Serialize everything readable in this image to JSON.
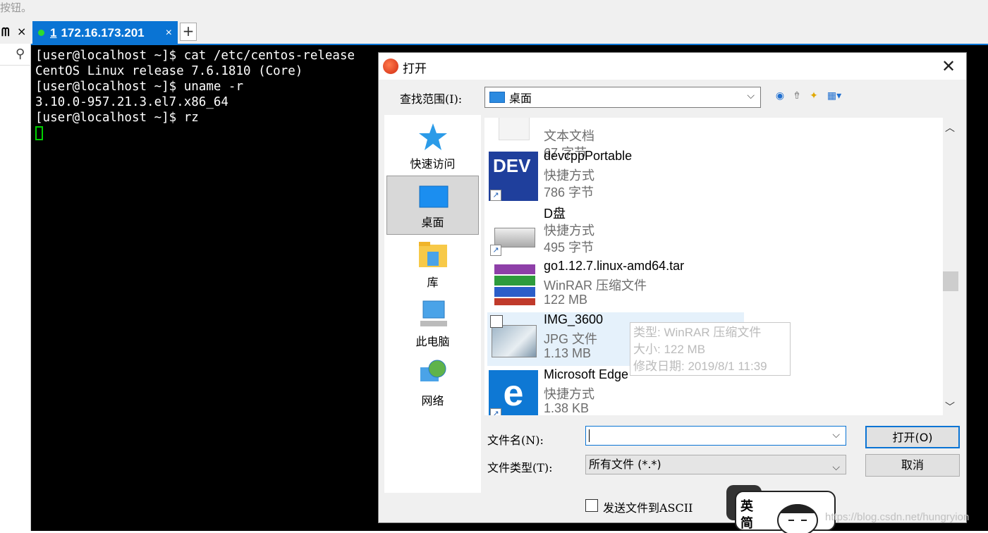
{
  "hint_text": "按钮。",
  "left_tab": {
    "pin_label": "ᗰ",
    "close_label": "×"
  },
  "session_tab": {
    "number": "1",
    "host": "172.16.173.201",
    "close_label": "×",
    "add_label": "+"
  },
  "terminal": {
    "lines": [
      "[user@localhost ~]$ cat /etc/centos-release",
      "CentOS Linux release 7.6.1810 (Core)",
      "[user@localhost ~]$ uname -r",
      "3.10.0-957.21.3.el7.x86_64",
      "[user@localhost ~]$ rz"
    ]
  },
  "dialog": {
    "title": "打开",
    "close_label": "✕",
    "lookin_label": "查找范围(I):",
    "lookin_value": "桌面",
    "places": [
      {
        "label": "快速访问",
        "icon": "star-icon"
      },
      {
        "label": "桌面",
        "icon": "desktop-icon"
      },
      {
        "label": "库",
        "icon": "library-folder-icon"
      },
      {
        "label": "此电脑",
        "icon": "computer-icon"
      },
      {
        "label": "网络",
        "icon": "network-icon"
      }
    ],
    "files": [
      {
        "name": "",
        "type": "文本文档",
        "size": "67 字节",
        "icon": "text-file-icon"
      },
      {
        "name": "devcppPortable",
        "type": "快捷方式",
        "size": "786 字节",
        "icon": "devcpp-icon"
      },
      {
        "name": "D盘",
        "type": "快捷方式",
        "size": "495 字节",
        "icon": "drive-icon"
      },
      {
        "name": "go1.12.7.linux-amd64.tar",
        "type": "WinRAR 压缩文件",
        "size": "122 MB",
        "icon": "winrar-icon"
      },
      {
        "name": "IMG_3600",
        "type": "JPG 文件",
        "size": "1.13 MB",
        "icon": "image-thumbnail-icon"
      },
      {
        "name": "Microsoft Edge",
        "type": "快捷方式",
        "size": "1.38 KB",
        "icon": "edge-icon"
      }
    ],
    "tooltip": {
      "type": "类型: WinRAR 压缩文件",
      "size": "大小: 122 MB",
      "modified": "修改日期: 2019/8/1 11:39"
    },
    "filename_label": "文件名(N):",
    "filename_value": "",
    "filetype_label": "文件类型(T):",
    "filetype_value": "所有文件 (*.*)",
    "open_button": "打开(O)",
    "cancel_button": "取消",
    "ascii_label": "发送文件到ASCII"
  },
  "ime": {
    "line1": "英",
    "line2": "简"
  },
  "watermark": "https://blog.csdn.net/hungryion"
}
